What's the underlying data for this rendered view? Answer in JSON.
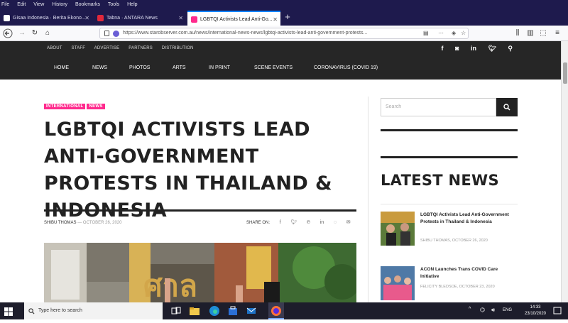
{
  "browser": {
    "menu": [
      "File",
      "Edit",
      "View",
      "History",
      "Bookmarks",
      "Tools",
      "Help"
    ],
    "tabs": [
      {
        "label": "Gisaa Indonesia · Berita Ekono..."
      },
      {
        "label": "Tabna · ANTARA News"
      },
      {
        "label": "LGBTQI Activists Lead Anti-Go..."
      }
    ],
    "url": "https://www.starobserver.com.au/news/international-news-news/lgbtqi-activists-lead-anti-government-protests...",
    "url_tail_icons": [
      "reader-icon",
      "dots-icon",
      "bookmark-star-icon"
    ]
  },
  "site": {
    "top_links": [
      "ABOUT",
      "STAFF",
      "ADVERTISE",
      "PARTNERS",
      "DISTRIBUTION"
    ],
    "main_nav": [
      "HOME",
      "NEWS",
      "PHOTOS",
      "ARTS",
      "IN PRINT",
      "SCENE EVENTS",
      "CORONAVIRUS (COVID 19)"
    ],
    "social_icons": [
      "facebook-icon",
      "instagram-icon",
      "linkedin-icon",
      "twitter-icon",
      "search-icon"
    ]
  },
  "article": {
    "tags": [
      "INTERNATIONAL",
      "NEWS"
    ],
    "headline": "LGBTQI ACTIVISTS LEAD ANTI-GOVERNMENT PROTESTS IN THAILAND & INDONESIA",
    "author": "SHIBU THOMAS",
    "date": "— OCTOBER 26, 2020",
    "share_label": "SHARE ON:"
  },
  "sidebar": {
    "search_placeholder": "Search",
    "latest_heading": "LATEST NEWS",
    "news": [
      {
        "title": "LGBTQI Activists Lead Anti-Government Protests in Thailand & Indonesia",
        "meta": "SHIBU THOMAS, OCTOBER 26, 2020"
      },
      {
        "title": "ACON Launches Trans COVID Care Initiative",
        "meta": "FELICITY BLEDSOE, OCTOBER 23, 2020"
      }
    ]
  },
  "taskbar": {
    "search_placeholder": "Type here to search",
    "tray_lang": "ENG",
    "time": "14:33",
    "date": "23/10/2020"
  }
}
